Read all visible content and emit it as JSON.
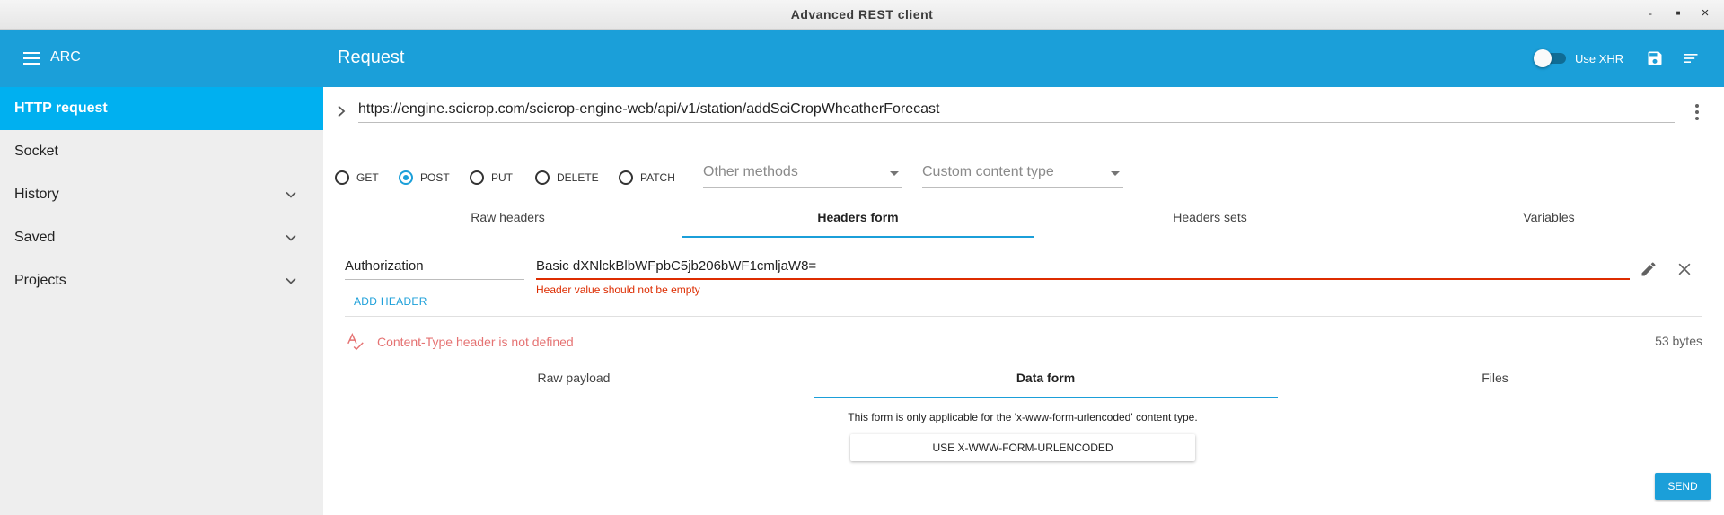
{
  "window": {
    "title": "Advanced REST client",
    "controls": [
      "-",
      "■",
      "×"
    ]
  },
  "appbar": {
    "app_name": "ARC",
    "title": "Request",
    "xhr_label": "Use XHR",
    "xhr_enabled": false
  },
  "sidebar": {
    "items": [
      {
        "label": "HTTP request",
        "active": true,
        "expandable": false
      },
      {
        "label": "Socket",
        "active": false,
        "expandable": false
      },
      {
        "label": "History",
        "active": false,
        "expandable": true
      },
      {
        "label": "Saved",
        "active": false,
        "expandable": true
      },
      {
        "label": "Projects",
        "active": false,
        "expandable": true
      }
    ]
  },
  "request": {
    "url": "https://engine.scicrop.com/scicrop-engine-web/api/v1/station/addSciCropWheatherForecast",
    "methods": [
      "GET",
      "POST",
      "PUT",
      "DELETE",
      "PATCH"
    ],
    "selected_method": "POST",
    "other_methods_placeholder": "Other methods",
    "content_type_placeholder": "Custom content type"
  },
  "header_tabs": {
    "items": [
      "Raw headers",
      "Headers form",
      "Headers sets",
      "Variables"
    ],
    "active": "Headers form"
  },
  "headers": {
    "name": "Authorization",
    "value": "Basic dXNlckBlbWFpbC5jb206bWF1cmljaW8=",
    "error": "Header value should not be empty",
    "add_label": "ADD HEADER"
  },
  "payload": {
    "warning": "Content-Type header is not defined",
    "size": "53 bytes",
    "tabs": [
      "Raw payload",
      "Data form",
      "Files"
    ],
    "active_tab": "Data form",
    "note": "This form is only applicable for the 'x-www-form-urlencoded' content type.",
    "urlencoded_button": "USE X-WWW-FORM-URLENCODED",
    "send_label": "SEND"
  },
  "colors": {
    "accent": "#1b9fd9",
    "sidebar_active": "#00b0f0",
    "error": "#dd2c00",
    "warning": "#e57373"
  }
}
